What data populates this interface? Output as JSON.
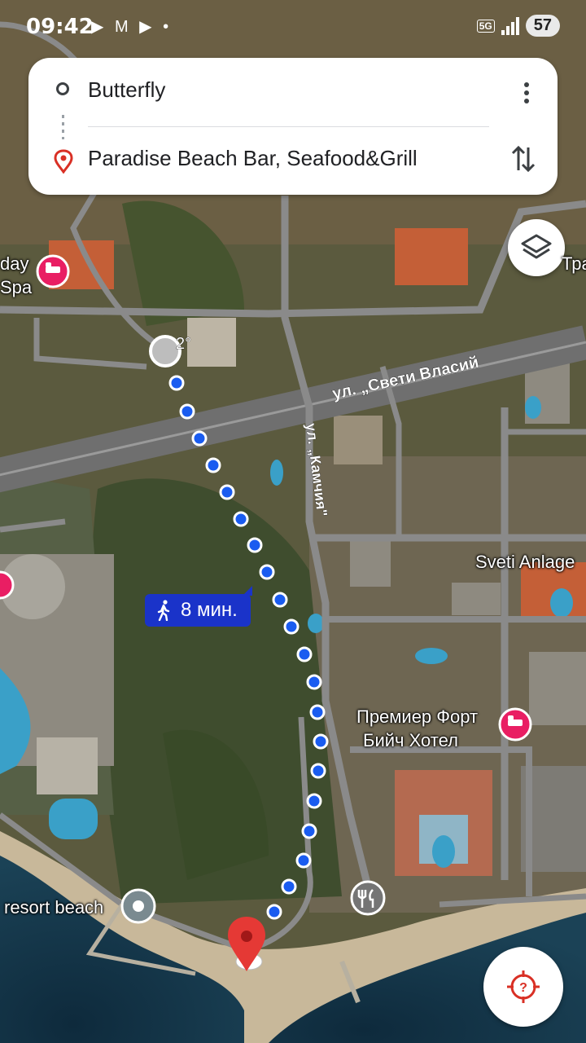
{
  "status_bar": {
    "time": "09:42",
    "app_icons": "▶ M ▶ •",
    "network": "5G",
    "battery": "57"
  },
  "route": {
    "origin": "Butterfly",
    "destination": "Paradise Beach Bar, Seafood&Grill",
    "duration": "8 мин.",
    "mode_icon": "walking-icon"
  },
  "map_labels": {
    "hotel_left_top": "day",
    "hotel_left_bottom": "Spa",
    "edge_right": "Тра",
    "hotel_sveti": "Sveti Anlage",
    "hotel_premier_1": "Премиер Форт",
    "hotel_premier_2": "Бийч Хотел",
    "resort_beach": "resort beach",
    "building_number": "2°",
    "street_sveti_vlasiy": "ул. „Свети Власий",
    "street_kamchia": "ул. „Камчия\""
  },
  "colors": {
    "route_blue": "#1a33c9",
    "destination_red": "#e53935",
    "hotel_pink": "#e91e63"
  }
}
